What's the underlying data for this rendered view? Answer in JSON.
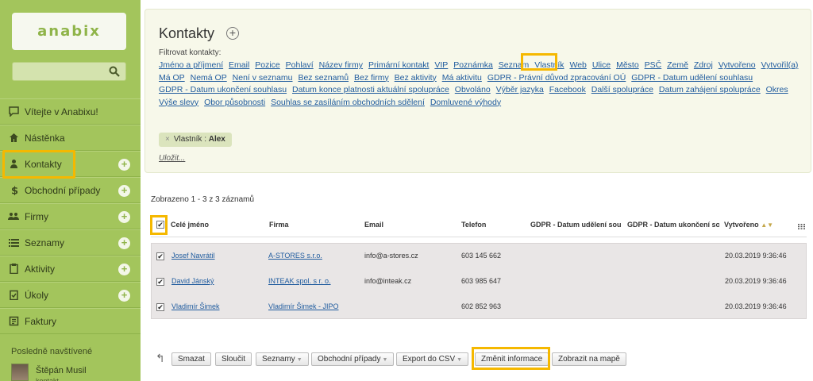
{
  "app": {
    "logo": "anabix"
  },
  "sidebar": {
    "items": [
      {
        "label": "Vítejte v Anabixu!",
        "icon": "chat-icon",
        "plus": false
      },
      {
        "label": "Nástěnka",
        "icon": "home-icon",
        "plus": false
      },
      {
        "label": "Kontakty",
        "icon": "person-icon",
        "plus": true
      },
      {
        "label": "Obchodní případy",
        "icon": "dollar-icon",
        "plus": true
      },
      {
        "label": "Firmy",
        "icon": "group-icon",
        "plus": true
      },
      {
        "label": "Seznamy",
        "icon": "list-icon",
        "plus": true
      },
      {
        "label": "Aktivity",
        "icon": "clipboard-icon",
        "plus": true
      },
      {
        "label": "Úkoly",
        "icon": "checklist-icon",
        "plus": true
      },
      {
        "label": "Faktury",
        "icon": "invoice-icon",
        "plus": false
      }
    ],
    "plus_symbol": "+",
    "recent_title": "Posledně navštívené",
    "recent": {
      "name": "Štěpán Musil",
      "sub": "kontakt"
    }
  },
  "filter": {
    "title": "Kontakty",
    "title_plus": "+",
    "label": "Filtrovat kontakty:",
    "links": [
      "Jméno a příjmení",
      "Email",
      "Pozice",
      "Pohlaví",
      "Název firmy",
      "Primární kontakt",
      "VIP",
      "Poznámka",
      "Seznam",
      "Vlastník",
      "Web",
      "Ulice",
      "Město",
      "PSČ",
      "Země",
      "Zdroj",
      "Vytvořeno",
      "Vytvořil(a)",
      "Má OP",
      "Nemá OP",
      "Není v seznamu",
      "Bez seznamů",
      "Bez firmy",
      "Bez aktivity",
      "Má aktivitu",
      "GDPR - Právní důvod zpracování OÚ",
      "GDPR - Datum udělení souhlasu",
      "GDPR - Datum ukončení souhlasu",
      "Datum konce platnosti aktuální spolupráce",
      "Obvoláno",
      "Výběr jazyka",
      "Facebook",
      "Další spolupráce",
      "Datum zahájení spolupráce",
      "Okres",
      "Výše slevy",
      "Obor působnosti",
      "Souhlas se zasíláním obchodních sdělení",
      "Domluvené výhody"
    ],
    "active_tag": {
      "close": "×",
      "label": "Vlastník : ",
      "value": "Alex"
    },
    "save_label": "Uložit..."
  },
  "table": {
    "shown": "Zobrazeno 1 - 3 z 3 záznamů",
    "headers": [
      "Celé jméno",
      "Firma",
      "Email",
      "Telefon",
      "GDPR - Datum udělení souhlasu",
      "GDPR - Datum ukončení souhlasu",
      "Vytvořeno"
    ],
    "sort_marker": "▲▼",
    "check_mark": "✔",
    "rows": [
      {
        "name": "Josef Navrátil",
        "company": "A-STORES s.r.o.",
        "email": "info@a-stores.cz",
        "phone": "603 145 662",
        "created": "20.03.2019 9:36:46"
      },
      {
        "name": "David Jánský",
        "company": "INTEAK spol. s r. o.",
        "email": "info@inteak.cz",
        "phone": "603 985 647",
        "created": "20.03.2019 9:36:46"
      },
      {
        "name": "Vladimír Šimek",
        "company": "Vladimír Šimek - JIPO",
        "email": "",
        "phone": "602 852 963",
        "created": "20.03.2019 9:36:46"
      }
    ]
  },
  "actions": {
    "back_arrow": "↰",
    "caret": "▼",
    "buttons": [
      {
        "label": "Smazat",
        "caret": false
      },
      {
        "label": "Sloučit",
        "caret": false
      },
      {
        "label": "Seznamy",
        "caret": true
      },
      {
        "label": "Obchodní případy",
        "caret": true
      },
      {
        "label": "Export do CSV",
        "caret": true
      },
      {
        "label": "Změnit informace",
        "caret": false
      },
      {
        "label": "Zobrazit na mapě",
        "caret": false
      }
    ]
  },
  "colors": {
    "sidebar": "#a3c55c",
    "highlight": "#f5b800",
    "link": "#1f5b9e"
  }
}
